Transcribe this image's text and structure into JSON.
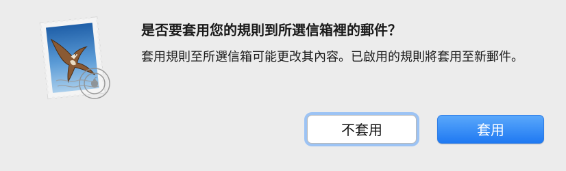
{
  "dialog": {
    "title": "是否要套用您的規則到所選信箱裡的郵件？",
    "message": "套用規則至所選信箱可能更改其內容。已啟用的規則將套用至新郵件。"
  },
  "icon": {
    "name": "mail-app-icon"
  },
  "buttons": {
    "cancel_label": "不套用",
    "apply_label": "套用"
  },
  "colors": {
    "background": "#ececec",
    "accent": "#1f79f2",
    "focus_ring": "#9cc3f4"
  }
}
